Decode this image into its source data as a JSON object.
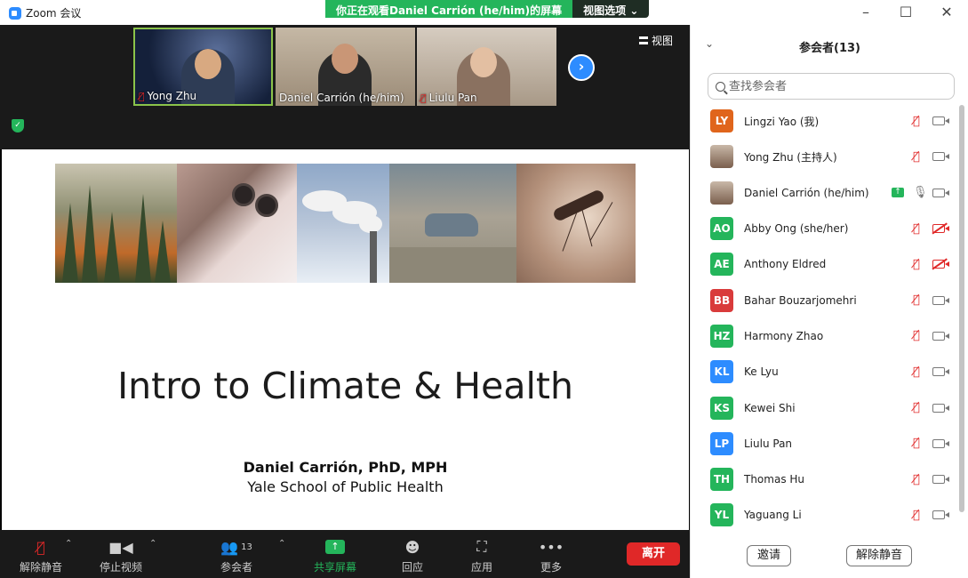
{
  "window": {
    "app_title": "Zoom 会议",
    "share_banner": "你正在观看Daniel Carrión (he/him)的屏幕",
    "view_options": "视图选项 ⌄",
    "min": "–",
    "max": "☐",
    "close": "✕"
  },
  "gallery": {
    "view_label": "视图",
    "thumbnails": [
      {
        "name": "Yong Zhu",
        "muted": true
      },
      {
        "name": "Daniel Carrión (he/him)",
        "muted": false
      },
      {
        "name": "Liulu Pan",
        "muted": true
      }
    ]
  },
  "slide": {
    "title": "Intro to Climate & Health",
    "author": "Daniel Carrión, PhD, MPH",
    "affiliation": "Yale School of Public Health"
  },
  "toolbar": {
    "unmute": "解除静音",
    "stop_video": "停止视频",
    "participants": "参会者",
    "participants_count": "13",
    "share_screen": "共享屏幕",
    "reactions": "回应",
    "apps": "应用",
    "more": "更多",
    "leave": "离开"
  },
  "panel": {
    "title": "参会者(13)",
    "search_placeholder": "查找参会者",
    "invite": "邀请",
    "unmute_all": "解除静音",
    "participants": [
      {
        "initials": "LY",
        "name": "Lingzi Yao (我)",
        "color": "#e0651c",
        "mic": "muted",
        "cam": "on"
      },
      {
        "initials": "",
        "name": "Yong Zhu (主持人)",
        "color": "",
        "mic": "muted",
        "cam": "on"
      },
      {
        "initials": "",
        "name": "Daniel Carrión (he/him)",
        "color": "",
        "mic": "on",
        "cam": "on",
        "sharing": true
      },
      {
        "initials": "AO",
        "name": "Abby Ong (she/her)",
        "color": "#24b55b",
        "mic": "muted",
        "cam": "off"
      },
      {
        "initials": "AE",
        "name": "Anthony Eldred",
        "color": "#24b55b",
        "mic": "muted",
        "cam": "off"
      },
      {
        "initials": "BB",
        "name": "Bahar Bouzarjomehri",
        "color": "#d93b3b",
        "mic": "muted",
        "cam": "on"
      },
      {
        "initials": "HZ",
        "name": "Harmony Zhao",
        "color": "#24b55b",
        "mic": "muted",
        "cam": "on"
      },
      {
        "initials": "KL",
        "name": "Ke Lyu",
        "color": "#2d8cff",
        "mic": "muted",
        "cam": "on"
      },
      {
        "initials": "KS",
        "name": "Kewei Shi",
        "color": "#24b55b",
        "mic": "muted",
        "cam": "on"
      },
      {
        "initials": "LP",
        "name": "Liulu Pan",
        "color": "#2d8cff",
        "mic": "muted",
        "cam": "on"
      },
      {
        "initials": "TH",
        "name": "Thomas Hu",
        "color": "#24b55b",
        "mic": "muted",
        "cam": "on"
      },
      {
        "initials": "YL",
        "name": "Yaguang Li",
        "color": "#24b55b",
        "mic": "muted",
        "cam": "on"
      }
    ]
  }
}
